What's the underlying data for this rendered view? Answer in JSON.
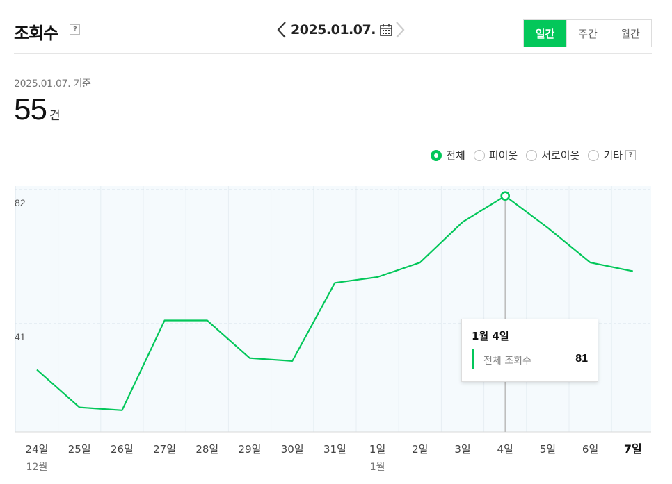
{
  "header": {
    "title": "조회수",
    "date": "2025.01.07.",
    "period_tabs": [
      "일간",
      "주간",
      "월간"
    ],
    "active_tab": "일간"
  },
  "summary": {
    "basis": "2025.01.07. 기준",
    "count": "55",
    "unit": "건"
  },
  "legend": {
    "options": [
      "전체",
      "피이웃",
      "서로이웃",
      "기타"
    ],
    "selected": "전체"
  },
  "tooltip": {
    "title": "1월 4일",
    "label": "전체 조회수",
    "value": "81"
  },
  "colors": {
    "accent": "#03c75a"
  },
  "chart_data": {
    "type": "line",
    "categories": [
      "24일",
      "25일",
      "26일",
      "27일",
      "28일",
      "29일",
      "30일",
      "31일",
      "1일",
      "2일",
      "3일",
      "4일",
      "5일",
      "6일",
      "7일"
    ],
    "month_labels": [
      {
        "index": 0,
        "label": "12월"
      },
      {
        "index": 8,
        "label": "1월"
      }
    ],
    "bold_category_index": 14,
    "series": [
      {
        "values": [
          21,
          8,
          7,
          38,
          38,
          25,
          24,
          51,
          53,
          58,
          72,
          81,
          70,
          58,
          55
        ]
      }
    ],
    "y_ticks": [
      82,
      41
    ],
    "ylim": [
      0,
      82
    ],
    "highlight_index": 11
  }
}
